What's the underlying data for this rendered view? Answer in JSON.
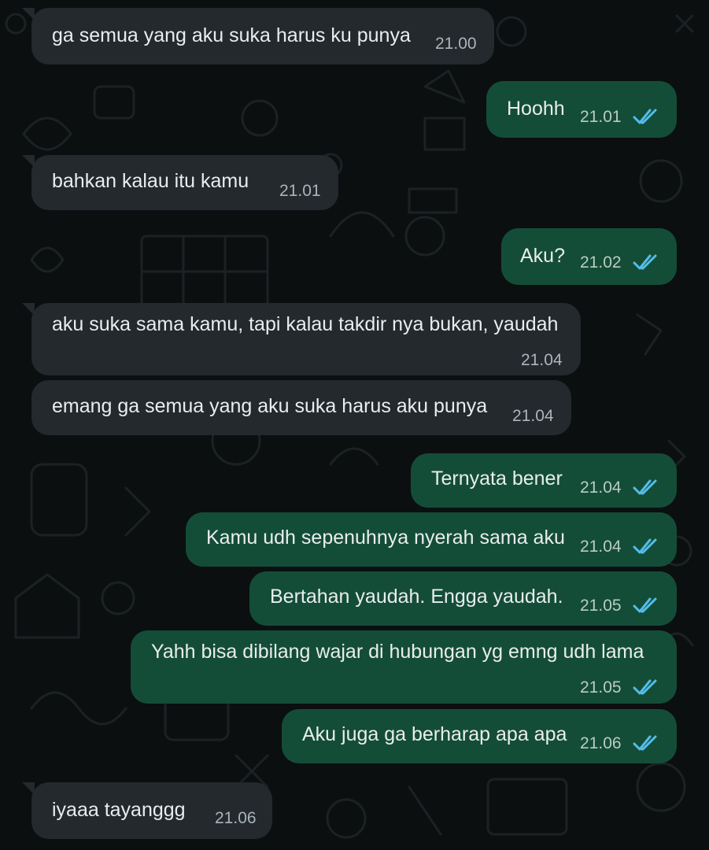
{
  "chat": {
    "messages": [
      {
        "dir": "in",
        "text": "ga semua yang aku suka harus ku punya",
        "time": "21.00"
      },
      {
        "dir": "out",
        "text": "Hoohh",
        "time": "21.01",
        "read": true
      },
      {
        "dir": "in",
        "text": "bahkan kalau itu kamu",
        "time": "21.01"
      },
      {
        "dir": "out",
        "text": "Aku?",
        "time": "21.02",
        "read": true
      },
      {
        "dir": "in",
        "text": "aku suka sama kamu, tapi kalau takdir nya bukan, yaudah",
        "time": "21.04"
      },
      {
        "dir": "in",
        "text": "emang ga semua yang aku suka harus aku punya",
        "time": "21.04"
      },
      {
        "dir": "out",
        "text": "Ternyata bener",
        "time": "21.04",
        "read": true
      },
      {
        "dir": "out",
        "text": "Kamu udh sepenuhnya nyerah sama aku",
        "time": "21.04",
        "read": true
      },
      {
        "dir": "out",
        "text": "Bertahan yaudah. Engga yaudah.",
        "time": "21.05",
        "read": true
      },
      {
        "dir": "out",
        "text": "Yahh bisa dibilang wajar di hubungan yg emng udh lama",
        "time": "21.05",
        "read": true
      },
      {
        "dir": "out",
        "text": "Aku juga ga berharap apa apa",
        "time": "21.06",
        "read": true
      },
      {
        "dir": "in",
        "text": "iyaaa tayanggg",
        "time": "21.06"
      }
    ]
  },
  "colors": {
    "background": "#0b0f10",
    "incoming_bubble": "#23292c",
    "outgoing_bubble": "#144d37",
    "read_tick": "#53bdeb"
  },
  "icons": {
    "read_receipt": "double-check-icon"
  }
}
